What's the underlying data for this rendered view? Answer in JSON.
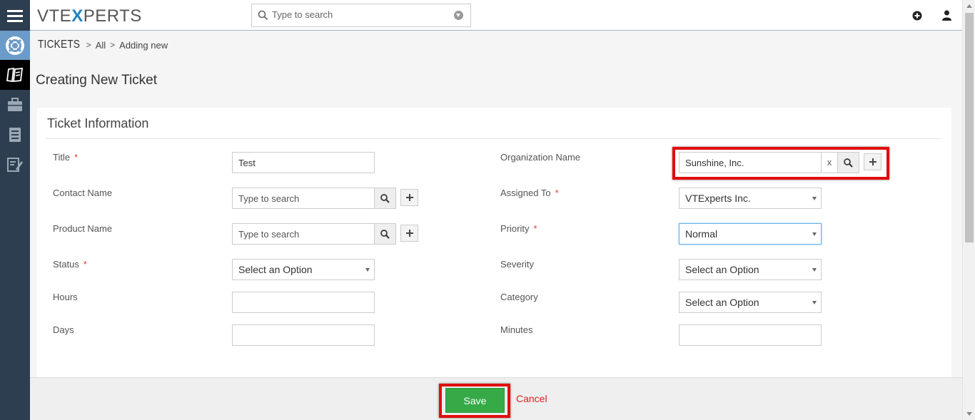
{
  "app": {
    "logo_prefix": "VTE",
    "logo_x": "X",
    "logo_suffix": "PERTS"
  },
  "search": {
    "placeholder": "Type to search"
  },
  "breadcrumb": {
    "module": "TICKETS",
    "items": [
      "All",
      "Adding new"
    ]
  },
  "page_title": "Creating New Ticket",
  "section_title": "Ticket Information",
  "fields": {
    "title": {
      "label": "Title",
      "required": "*",
      "value": "Test"
    },
    "contact_name": {
      "label": "Contact Name",
      "placeholder": "Type to search"
    },
    "product_name": {
      "label": "Product Name",
      "placeholder": "Type to search"
    },
    "status": {
      "label": "Status",
      "required": "*",
      "value": "Select an Option"
    },
    "hours": {
      "label": "Hours",
      "value": ""
    },
    "days": {
      "label": "Days",
      "value": ""
    },
    "organization_name": {
      "label": "Organization Name",
      "value": "Sunshine, Inc.",
      "clear": "x"
    },
    "assigned_to": {
      "label": "Assigned To",
      "required": "*",
      "value": "VTExperts Inc."
    },
    "priority": {
      "label": "Priority",
      "required": "*",
      "value": "Normal"
    },
    "severity": {
      "label": "Severity",
      "value": "Select an Option"
    },
    "category": {
      "label": "Category",
      "value": "Select an Option"
    },
    "minutes": {
      "label": "Minutes",
      "value": ""
    }
  },
  "footer": {
    "save_label": "Save",
    "cancel_label": "Cancel"
  },
  "colors": {
    "rail": "#2d3e50",
    "accent_blue": "#1d82c4",
    "save_green": "#35aa47",
    "highlight_red": "#e00d0d",
    "cancel_red": "#e02020"
  },
  "icons": [
    "menu-icon",
    "help-lifebuoy-icon",
    "tickets-icon",
    "briefcase-icon",
    "documents-icon",
    "notes-icon",
    "search-icon",
    "add-circle-icon",
    "user-icon",
    "plus-icon"
  ]
}
